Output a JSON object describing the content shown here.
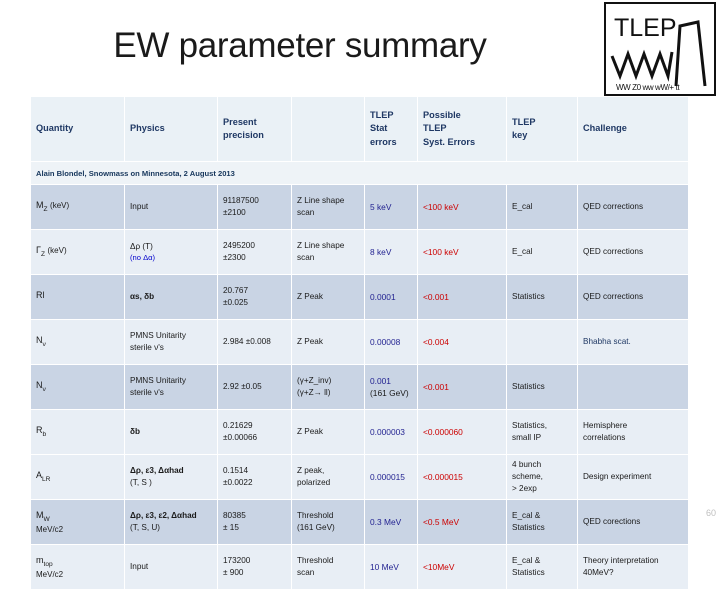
{
  "title": "EW parameter summary",
  "logo": {
    "name": "TLEP",
    "subtitle": "WW  Z0 ww  wW/+ tt"
  },
  "slide_number": "60",
  "note": "Alain Blondel, Snowmass on Minnesota, 2 August 2013",
  "colors": {
    "header_bg": "#eaf1f6",
    "header_text": "#1f3864",
    "row_dark": "#c9d4e4",
    "row_light": "#e8eef5",
    "stat_blue": "#1f1f8f",
    "syst_red": "#cc0000"
  },
  "table": {
    "headers": [
      "Quantity",
      "Physics",
      "Present precision",
      "",
      "TLEP Stat errors",
      "Possible TLEP Syst. Errors",
      "TLEP key",
      "Challenge"
    ],
    "headers_lines": {
      "h0": "Quantity",
      "h1": "Physics",
      "h2a": "Present",
      "h2b": "precision",
      "h3": "",
      "h4a": "TLEP",
      "h4b": "Stat",
      "h4c": "errors",
      "h5a": "Possible",
      "h5b": "TLEP",
      "h5c": "Syst. Errors",
      "h6a": "TLEP",
      "h6b": "key",
      "h7": "Challenge"
    },
    "rows": [
      {
        "quantity_main": "M",
        "quantity_sub": "Z",
        "quantity_unit": "(keV)",
        "physics": "Input",
        "physics2": "",
        "present_a": "91187500",
        "present_b": "±2100",
        "method_a": "Z Line shape",
        "method_b": "scan",
        "stat": "5 keV",
        "stat_extra": "",
        "syst": "<100 keV",
        "key_a": "E_cal",
        "key_b": "",
        "key_c": "",
        "challenge_a": "QED corrections",
        "challenge_b": ""
      },
      {
        "quantity_main": "Γ",
        "quantity_sub": "Z",
        "quantity_unit": "(keV)",
        "physics": "Δρ (T)",
        "physics2": "(no Δα)",
        "present_a": "2495200",
        "present_b": "±2300",
        "method_a": "Z Line shape",
        "method_b": "scan",
        "stat": "8 keV",
        "stat_extra": "",
        "syst": "<100 keV",
        "key_a": "E_cal",
        "key_b": "",
        "key_c": "",
        "challenge_a": "QED corrections",
        "challenge_b": ""
      },
      {
        "quantity_main": "Rl",
        "quantity_sub": "",
        "quantity_unit": "",
        "physics": "αs, δb",
        "physics2": "",
        "present_a": "20.767",
        "present_b": "±0.025",
        "method_a": "Z Peak",
        "method_b": "",
        "stat": "0.0001",
        "stat_extra": "",
        "syst": "<0.001",
        "key_a": "Statistics",
        "key_b": "",
        "key_c": "",
        "challenge_a": "QED corrections",
        "challenge_b": ""
      },
      {
        "quantity_main": "N",
        "quantity_sub": "ν",
        "quantity_unit": "",
        "physics": "PMNS Unitarity",
        "physics2": "sterile ν's",
        "present_a": "2.984 ±0.008",
        "present_b": "",
        "method_a": "Z Peak",
        "method_b": "",
        "stat": "0.00008",
        "stat_extra": "",
        "syst": "<0.004",
        "key_a": "",
        "key_b": "",
        "key_c": "",
        "challenge_a": "Bhabha scat.",
        "challenge_b": ""
      },
      {
        "quantity_main": "N",
        "quantity_sub": "ν",
        "quantity_unit": "",
        "physics": "PMNS Unitarity",
        "physics2": "sterile ν's",
        "present_a": "2.92 ±0.05",
        "present_b": "",
        "method_a": "(γ+Z_inv)",
        "method_b": "(γ+Z→ ll)",
        "stat": "0.001",
        "stat_extra": "(161 GeV)",
        "syst": "<0.001",
        "key_a": "Statistics",
        "key_b": "",
        "key_c": "",
        "challenge_a": "",
        "challenge_b": ""
      },
      {
        "quantity_main": "R",
        "quantity_sub": "b",
        "quantity_unit": "",
        "physics": "δb",
        "physics2": "",
        "present_a": "0.21629",
        "present_b": "±0.00066",
        "method_a": "Z Peak",
        "method_b": "",
        "stat": "0.000003",
        "stat_extra": "",
        "syst": "<0.000060",
        "key_a": "Statistics,",
        "key_b": "small IP",
        "key_c": "",
        "challenge_a": "Hemisphere",
        "challenge_b": "correlations"
      },
      {
        "quantity_main": "A",
        "quantity_sub": "LR",
        "quantity_unit": "",
        "physics": "Δρ, ε3, Δαhad",
        "physics2": "(T, S )",
        "present_a": "0.1514",
        "present_b": "±0.0022",
        "method_a": "Z peak,",
        "method_b": "polarized",
        "stat": "0.000015",
        "stat_extra": "",
        "syst": "<0.000015",
        "key_a": "4 bunch",
        "key_b": "scheme,",
        "key_c": "> 2exp",
        "challenge_a": "Design experiment",
        "challenge_b": ""
      },
      {
        "quantity_main": "M",
        "quantity_sub": "W",
        "quantity_unit": "MeV/c2",
        "physics": "Δρ, ε3, ε2, Δαhad",
        "physics2": "(T, S, U)",
        "present_a": "80385",
        "present_b": "± 15",
        "method_a": "Threshold",
        "method_b": "(161 GeV)",
        "stat": "0.3 MeV",
        "stat_extra": "",
        "syst": "<0.5 MeV",
        "key_a": "E_cal &",
        "key_b": "Statistics",
        "key_c": "",
        "challenge_a": "QED corections",
        "challenge_b": ""
      },
      {
        "quantity_main": "m",
        "quantity_sub": "top",
        "quantity_unit": "MeV/c2",
        "physics": "Input",
        "physics2": "",
        "present_a": "173200",
        "present_b": "± 900",
        "method_a": "Threshold",
        "method_b": "scan",
        "stat": "10 MeV",
        "stat_extra": "",
        "syst": "<10MeV",
        "key_a": "E_cal &",
        "key_b": "Statistics",
        "key_c": "",
        "challenge_a": "Theory interpretation",
        "challenge_b": "40MeV?"
      }
    ]
  }
}
